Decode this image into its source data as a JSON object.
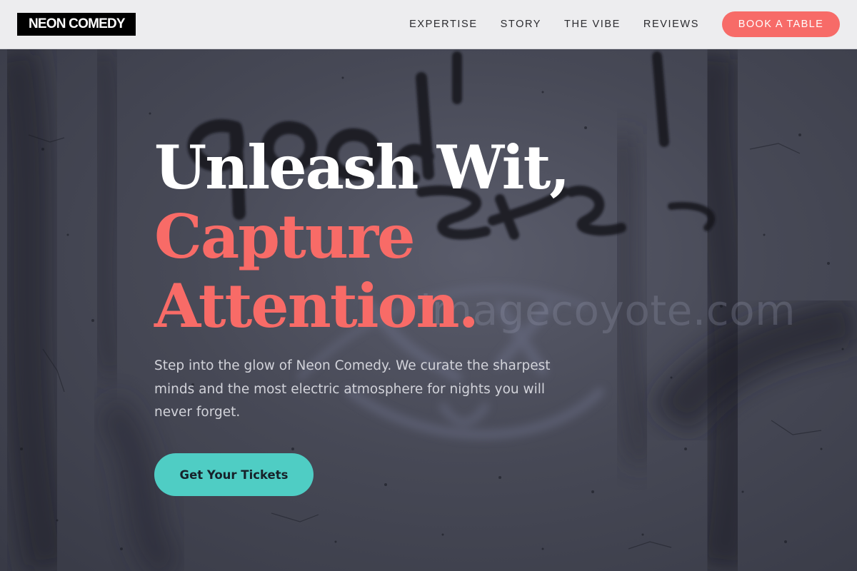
{
  "header": {
    "logo_text": "NEON COMEDY",
    "nav": [
      {
        "label": "EXPERTISE"
      },
      {
        "label": "STORY"
      },
      {
        "label": "THE VIBE"
      },
      {
        "label": "REVIEWS"
      }
    ],
    "cta_label": "BOOK A TABLE"
  },
  "hero": {
    "title_line_1": "Unleash Wit,",
    "title_line_2": "Capture",
    "title_line_3": "Attention.",
    "description": "Step into the glow of Neon Comedy. We curate the sharpest minds and the most electric atmosphere for nights you will never forget.",
    "cta_label": "Get Your Tickets",
    "watermark": "imagecoyote.com",
    "background_image": "graffiti-wall-photo"
  },
  "colors": {
    "accent_coral": "#f86b67",
    "accent_teal": "#4fcdc4",
    "header_bg": "#ededef",
    "hero_bg": "#474956",
    "logo_bg": "#000000"
  }
}
